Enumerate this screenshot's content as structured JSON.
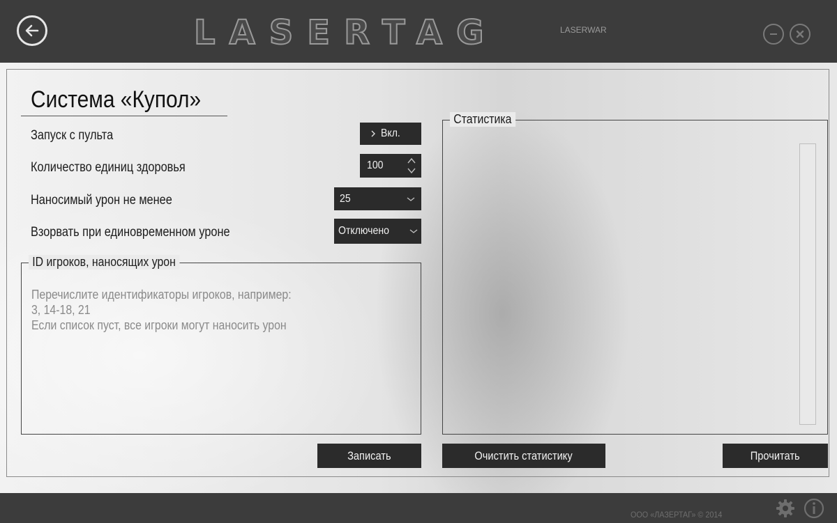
{
  "window": {
    "logo_text": "LASERTAG",
    "logo_sub": "LASERWAR"
  },
  "page": {
    "title": "Система «Купол»"
  },
  "settings": {
    "remote_launch_label": "Запуск с пульта",
    "remote_launch_value": "Вкл.",
    "health_units_label": "Количество единиц здоровья",
    "health_units_value": "100",
    "min_damage_label": "Наносимый урон не менее",
    "min_damage_value": "25",
    "explode_label": "Взорвать при единовременном уроне",
    "explode_value": "Отключено"
  },
  "player_ids": {
    "legend": "ID игроков, наносящих урон",
    "placeholder": "Перечислите идентификаторы игроков, например:\n3, 14-18, 21\nЕсли список пуст, все игроки могут наносить урон"
  },
  "statistics": {
    "legend": "Статистика"
  },
  "buttons": {
    "write": "Записать",
    "clear_stats": "Очистить статистику",
    "read": "Прочитать"
  },
  "footer": {
    "copyright": "ООО «ЛАЗЕРТАГ» © 2014"
  },
  "icons": {
    "back": "back-arrow-icon",
    "minimize": "minimize-icon",
    "close": "close-icon",
    "settings": "gear-icon",
    "info": "info-icon",
    "toggle": "chevron-right-icon",
    "stepper": "stepper-icon",
    "dropdown": "chevron-down-icon"
  },
  "colors": {
    "dark_bar": "#3c3c3c",
    "control_bg": "#2b2b2b"
  }
}
